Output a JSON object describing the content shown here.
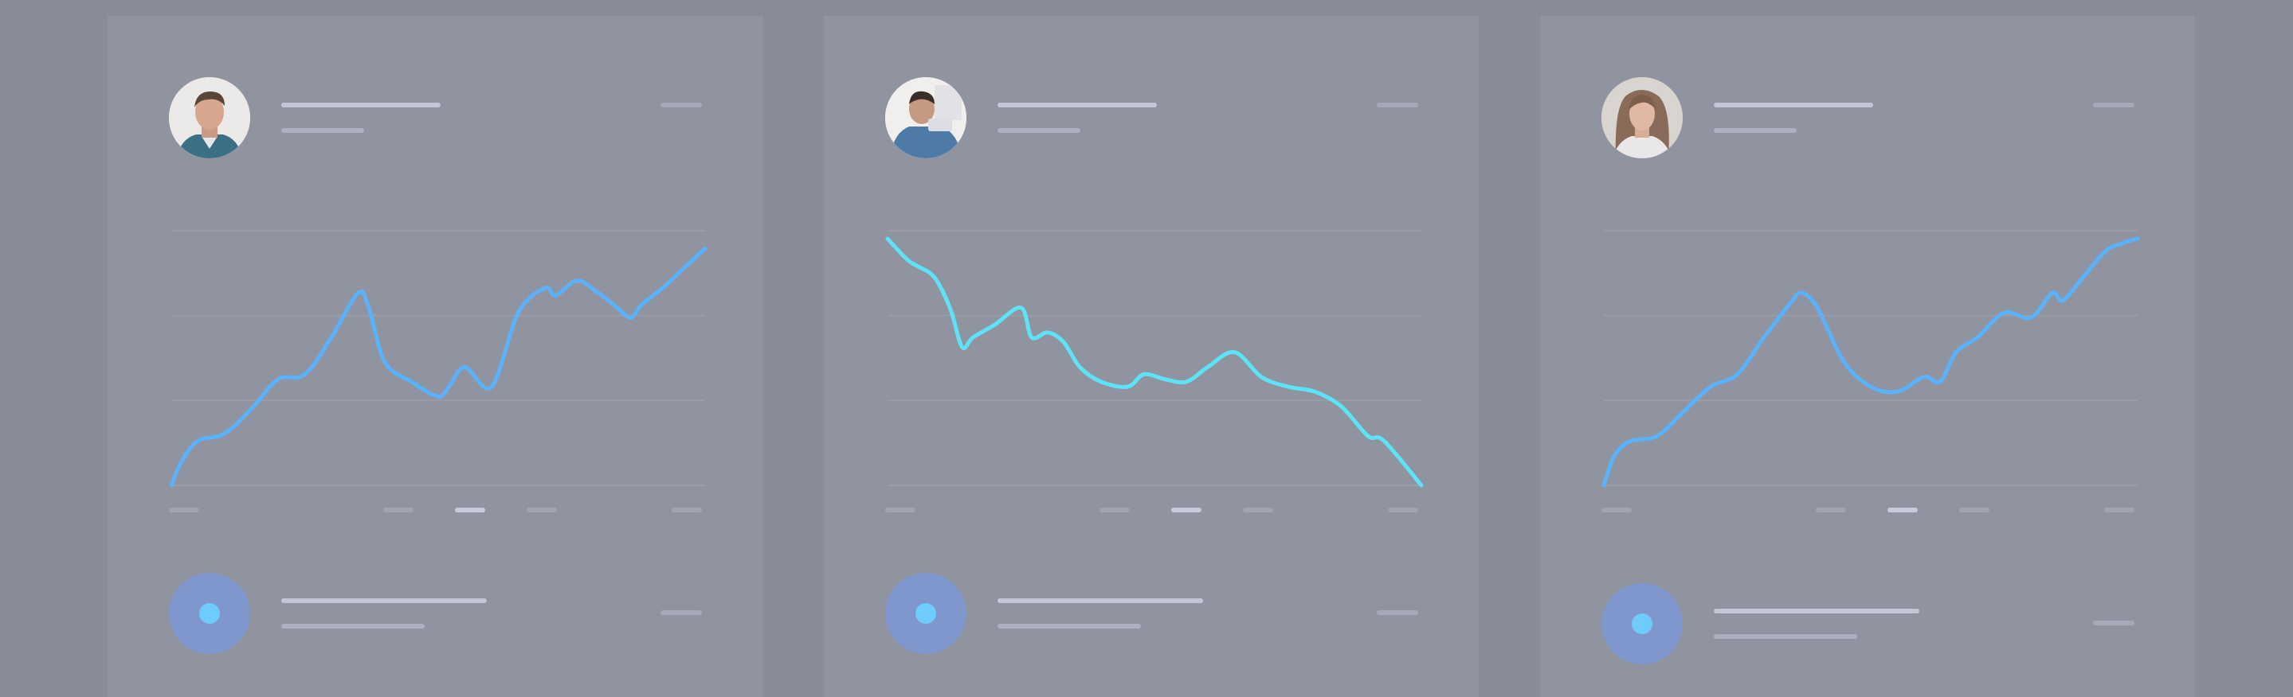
{
  "colors": {
    "background": "#898b97",
    "card": "#9093a0",
    "line_blue": "#5ab2fa",
    "line_cyan": "#5ee2f6",
    "badge": "#7f97cc",
    "badge_dot": "#6ecbfb"
  },
  "cards": [
    {
      "avatar": "avatar-man-photo",
      "active_tick_index": 2,
      "chart_data": {
        "type": "line",
        "color": "#5ab2fa",
        "x": [
          0,
          0.02,
          0.05,
          0.1,
          0.15,
          0.2,
          0.25,
          0.3,
          0.35,
          0.37,
          0.4,
          0.45,
          0.5,
          0.52,
          0.55,
          0.6,
          0.65,
          0.7,
          0.72,
          0.76,
          0.8,
          0.83,
          0.86,
          0.88,
          0.92,
          0.96,
          1.0
        ],
        "values": [
          0,
          10,
          18,
          21,
          31,
          43,
          45,
          60,
          78,
          72,
          50,
          42,
          36,
          40,
          48,
          40,
          70,
          80,
          77,
          83,
          78,
          73,
          68,
          73,
          80,
          88,
          96
        ]
      },
      "footer_icon": "target-icon"
    },
    {
      "avatar": "avatar-person-photo",
      "active_tick_index": 2,
      "chart_data": {
        "type": "line",
        "color": "#5ee2f6",
        "x": [
          0,
          0.04,
          0.08,
          0.1,
          0.12,
          0.14,
          0.16,
          0.2,
          0.25,
          0.27,
          0.3,
          0.33,
          0.36,
          0.4,
          0.45,
          0.48,
          0.52,
          0.56,
          0.6,
          0.65,
          0.7,
          0.75,
          0.8,
          0.85,
          0.9,
          0.93,
          1.0
        ],
        "values": [
          100,
          91,
          86,
          80,
          70,
          56,
          60,
          65,
          72,
          60,
          62,
          58,
          48,
          42,
          40,
          45,
          43,
          42,
          48,
          54,
          44,
          40,
          38,
          32,
          20,
          18,
          0
        ]
      },
      "footer_icon": "target-icon"
    },
    {
      "avatar": "avatar-woman-photo",
      "active_tick_index": 2,
      "chart_data": {
        "type": "line",
        "color": "#5ab2fa",
        "x": [
          0,
          0.02,
          0.05,
          0.1,
          0.15,
          0.2,
          0.25,
          0.3,
          0.35,
          0.37,
          0.4,
          0.45,
          0.5,
          0.55,
          0.6,
          0.63,
          0.66,
          0.7,
          0.75,
          0.8,
          0.84,
          0.86,
          0.9,
          0.94,
          0.97,
          1.0
        ],
        "values": [
          0,
          12,
          18,
          20,
          30,
          40,
          45,
          60,
          74,
          78,
          72,
          50,
          40,
          38,
          44,
          42,
          54,
          60,
          70,
          68,
          78,
          75,
          85,
          95,
          98,
          100
        ]
      },
      "footer_icon": "target-icon"
    }
  ]
}
